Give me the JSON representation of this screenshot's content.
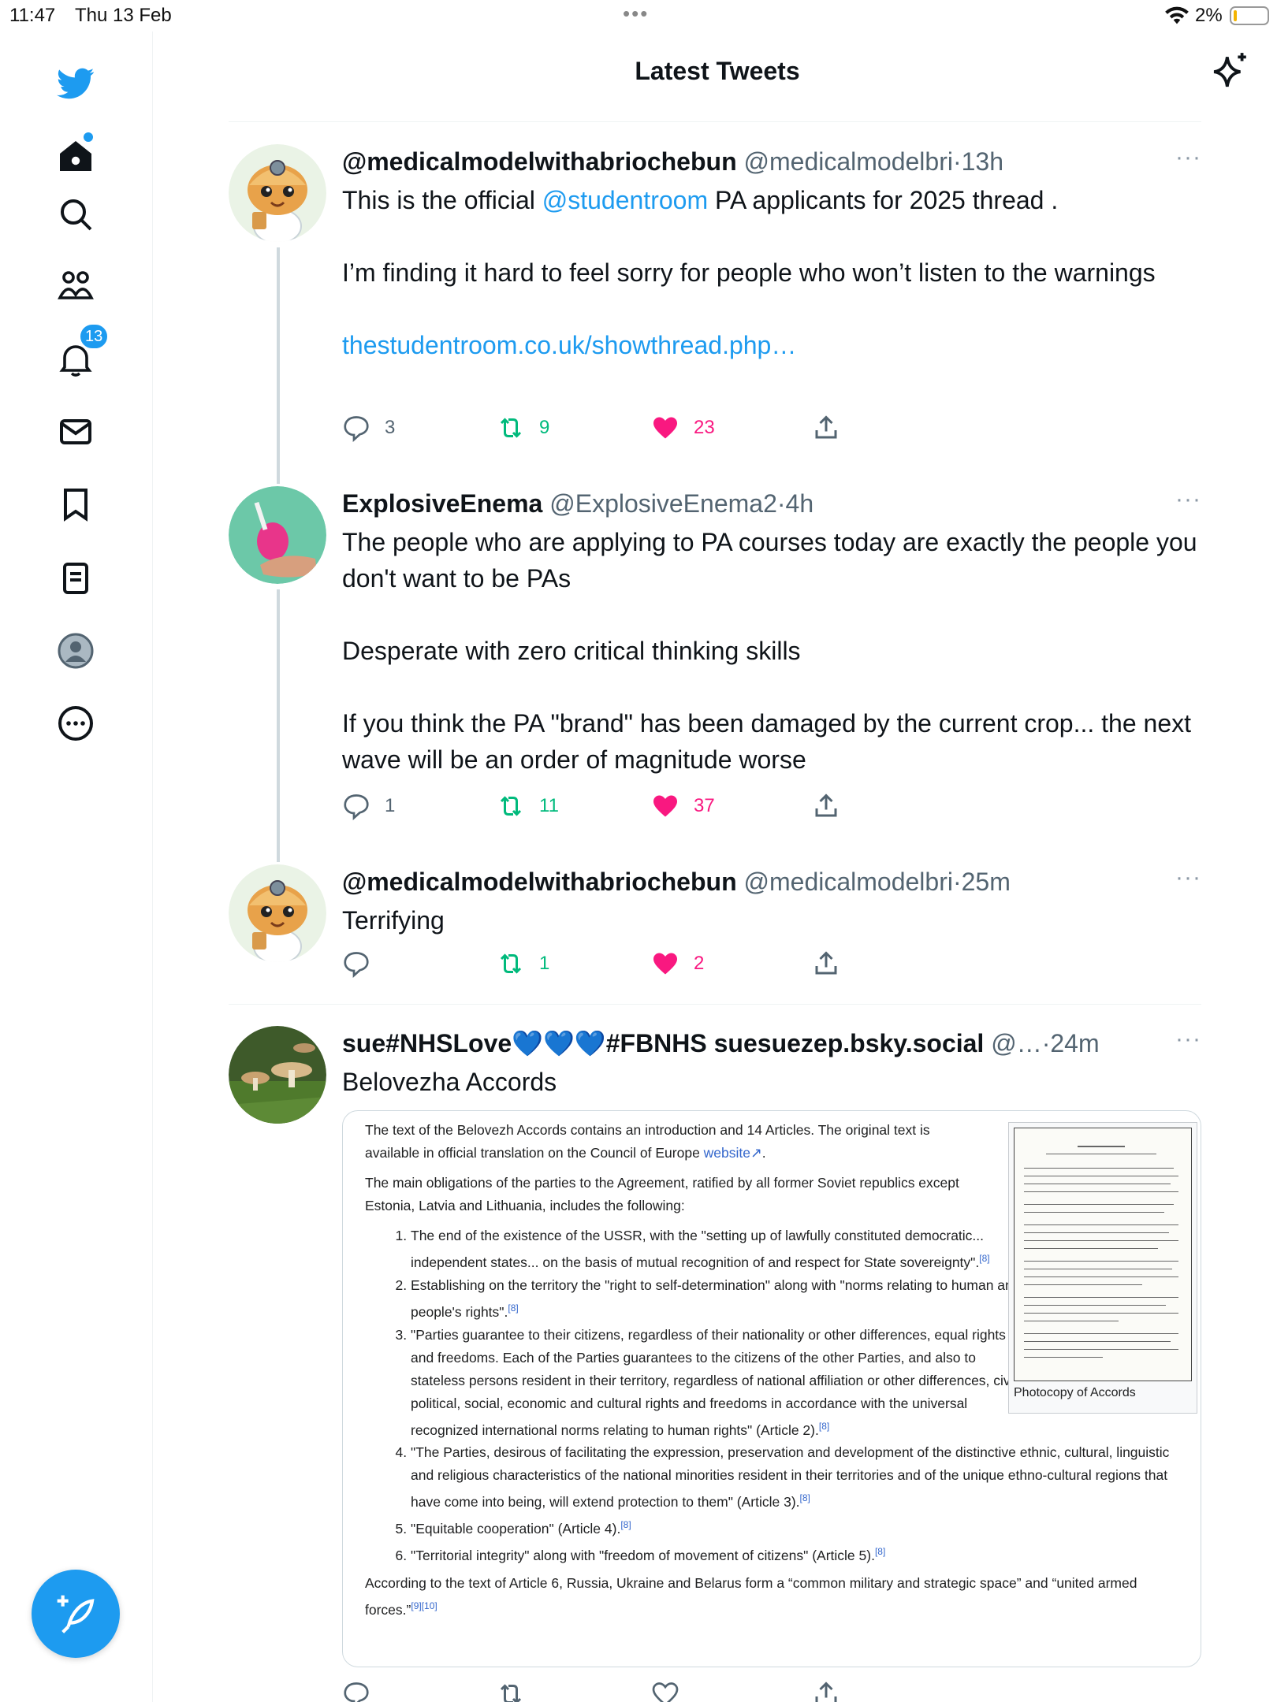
{
  "status_bar": {
    "time": "11:47",
    "date": "Thu 13 Feb",
    "more": "•••",
    "battery": "2%"
  },
  "sidebar": {
    "items": [
      {
        "name": "home",
        "icon": "home-icon"
      },
      {
        "name": "search",
        "icon": "search-icon"
      },
      {
        "name": "communities",
        "icon": "communities-icon"
      },
      {
        "name": "notifications",
        "icon": "bell-icon",
        "badge": "13"
      },
      {
        "name": "messages",
        "icon": "mail-icon"
      },
      {
        "name": "bookmarks",
        "icon": "bookmark-icon"
      },
      {
        "name": "lists",
        "icon": "list-icon"
      },
      {
        "name": "profile",
        "icon": "profile-icon"
      },
      {
        "name": "more",
        "icon": "more-icon"
      }
    ],
    "compose_icon": "compose-icon",
    "brand_color": "#1d9bf0"
  },
  "header": {
    "title": "Latest Tweets"
  },
  "tweets": [
    {
      "name": "@medicalmodelwithabriochebun",
      "handle": "@medicalmodelbri",
      "sep": "·",
      "time": "13h",
      "text_pre": "This is the official ",
      "mention": "@studentroom",
      "text_post": " PA applicants for 2025 thread .",
      "p2": "I’m finding it hard to feel sorry for people who won’t listen to the warnings",
      "link": "thestudentroom.co.uk/showthread.php…",
      "replies": "3",
      "retweets": "9",
      "likes": "23"
    },
    {
      "name": "ExplosiveEnema",
      "handle": "@ExplosiveEnema2",
      "sep": "·",
      "time": "4h",
      "p1": "The people who are applying to PA courses today are exactly the people you don't want to be PAs",
      "p2": "Desperate with zero critical thinking skills",
      "p3": "If you think the PA \"brand\" has been damaged by the current crop... the next wave will be an order of magnitude worse",
      "replies": "1",
      "retweets": "11",
      "likes": "37"
    },
    {
      "name": "@medicalmodelwithabriochebun",
      "handle": "@medicalmodelbri",
      "sep": "·",
      "time": "25m",
      "p1": "Terrifying",
      "replies": "",
      "retweets": "1",
      "likes": "2"
    },
    {
      "name": "sue#NHSLove💙💙💙#FBNHS suesuezep.bsky.social",
      "handle": "@…",
      "sep": "·",
      "time": "24m",
      "p1": "Belovezha Accords",
      "media": {
        "intro_1": "The text of the Belovezh Accords contains an introduction and 14 Articles. The original text is available in official translation on the Council of Europe ",
        "intro_link": "website",
        "intro_2": ".",
        "main": "The main obligations of the parties to the Agreement, ratified by all former Soviet republics except Estonia, Latvia and Lithuania, includes the following:",
        "list": [
          {
            "text": "The end of the existence of the USSR, with the \"setting up of lawfully constituted democratic... independent states... on the basis of mutual recognition of and respect for State sovereignty\".",
            "ref": "[8]"
          },
          {
            "text": "Establishing on the territory the \"right to self-determination\" along with \"norms relating to human and people's rights\".",
            "ref": "[8]"
          },
          {
            "text": "\"Parties guarantee to their citizens, regardless of their nationality or other differences, equal rights and freedoms. Each of the Parties guarantees to the citizens of the other Parties, and also to stateless persons resident in their territory, regardless of national affiliation or other differences, civil, political, social, economic and cultural rights and freedoms in accordance with the universal recognized international norms relating to human rights\" (Article 2).",
            "ref": "[8]"
          },
          {
            "text": "\"The Parties, desirous of facilitating the expression, preservation and development of the distinctive ethnic, cultural, linguistic and religious characteristics of the national minorities resident in their territories and of the unique ethno-cultural regions that have come into being, will extend protection to them\" (Article 3).",
            "ref": "[8]"
          },
          {
            "text": "\"Equitable cooperation\" (Article 4).",
            "ref": "[8]"
          },
          {
            "text": "\"Territorial integrity\" along with \"freedom of movement of citizens\" (Article 5).",
            "ref": "[8]"
          }
        ],
        "outro": "According to the text of Article 6, Russia, Ukraine and Belarus form a “common military and strategic space” and “united armed forces.”",
        "outro_ref": "[9][10]",
        "caption": "Photocopy of Accords"
      }
    }
  ]
}
